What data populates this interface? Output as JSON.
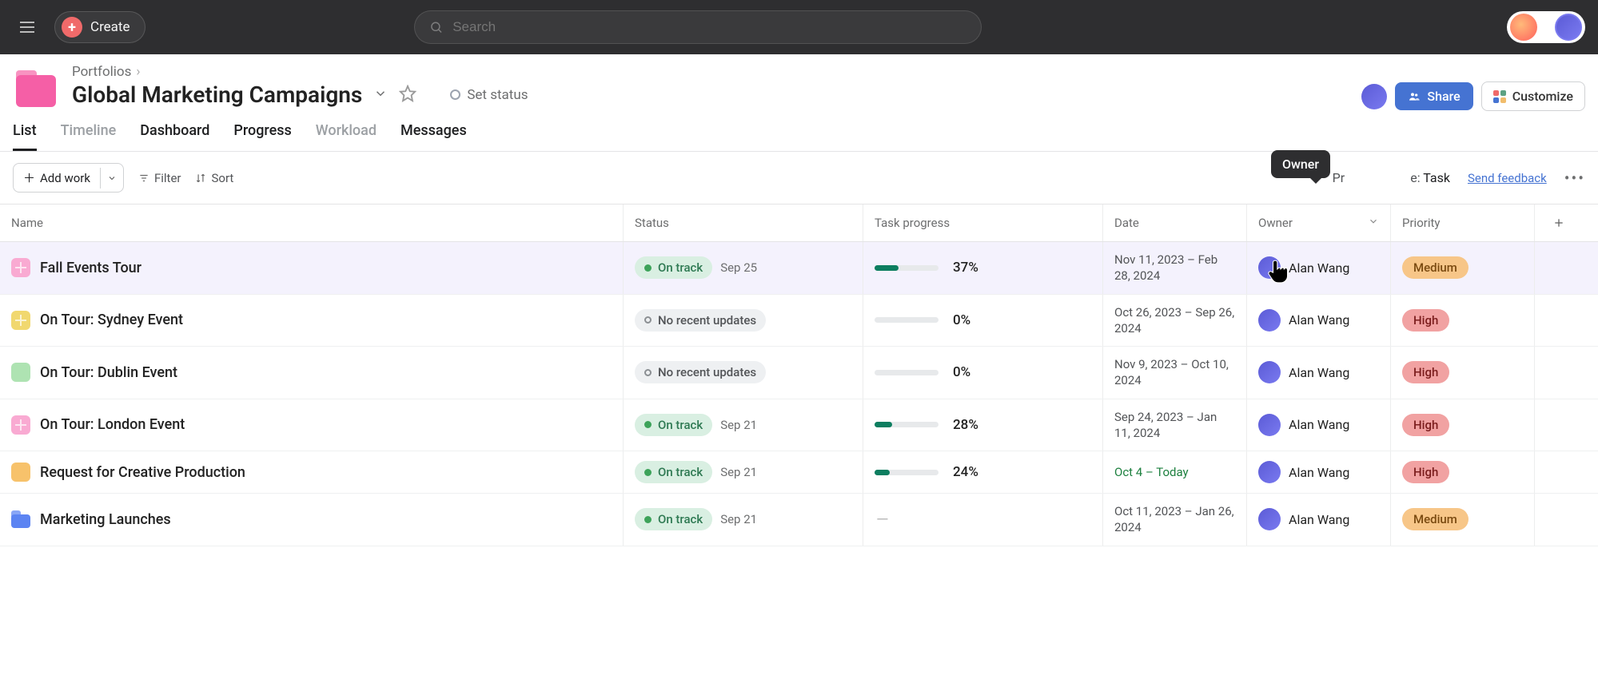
{
  "topbar": {
    "create_label": "Create",
    "search_placeholder": "Search"
  },
  "breadcrumb": {
    "root": "Portfolios"
  },
  "portfolio": {
    "title": "Global Marketing Campaigns",
    "set_status_label": "Set status"
  },
  "header_actions": {
    "share_label": "Share",
    "customize_label": "Customize"
  },
  "tabs": {
    "list": "List",
    "timeline": "Timeline",
    "dashboard": "Dashboard",
    "progress": "Progress",
    "workload": "Workload",
    "messages": "Messages"
  },
  "toolbar": {
    "add_work_label": "Add work",
    "filter_label": "Filter",
    "sort_label": "Sort",
    "progress_type_prefix": "Progress type:",
    "progress_type_value": "Task",
    "send_feedback_label": "Send feedback",
    "owner_tooltip": "Owner"
  },
  "columns": {
    "name": "Name",
    "status": "Status",
    "task_progress": "Task progress",
    "date": "Date",
    "owner": "Owner",
    "priority": "Priority"
  },
  "status_labels": {
    "on_track": "On track",
    "no_recent": "No recent updates"
  },
  "rows": [
    {
      "name": "Fall Events Tour",
      "icon": "pic-pink grid",
      "status": "on_track",
      "status_date": "Sep 25",
      "progress_pct": 37,
      "date": "Nov 11, 2023 – Feb 28, 2024",
      "owner": "Alan Wang",
      "priority": "Medium",
      "selected": true
    },
    {
      "name": "On Tour: Sydney Event",
      "icon": "pic-yellow grid",
      "status": "no_recent",
      "status_date": "",
      "progress_pct": 0,
      "date": "Oct 26, 2023 – Sep 26, 2024",
      "owner": "Alan Wang",
      "priority": "High"
    },
    {
      "name": "On Tour: Dublin Event",
      "icon": "pic-green",
      "status": "no_recent",
      "status_date": "",
      "progress_pct": 0,
      "date": "Nov 9, 2023 – Oct 10, 2024",
      "owner": "Alan Wang",
      "priority": "High"
    },
    {
      "name": "On Tour: London Event",
      "icon": "pic-pink grid",
      "status": "on_track",
      "status_date": "Sep 21",
      "progress_pct": 28,
      "date": "Sep 24, 2023 – Jan 11, 2024",
      "owner": "Alan Wang",
      "priority": "High"
    },
    {
      "name": "Request for Creative Production",
      "icon": "pic-orange",
      "status": "on_track",
      "status_date": "Sep 21",
      "progress_pct": 24,
      "date": "Oct 4 – Today",
      "date_green": true,
      "owner": "Alan Wang",
      "priority": "High"
    },
    {
      "name": "Marketing Launches",
      "icon": "folder",
      "status": "on_track",
      "status_date": "Sep 21",
      "progress_pct": null,
      "date": "Oct 11, 2023 – Jan 26, 2024",
      "owner": "Alan Wang",
      "priority": "Medium"
    }
  ]
}
